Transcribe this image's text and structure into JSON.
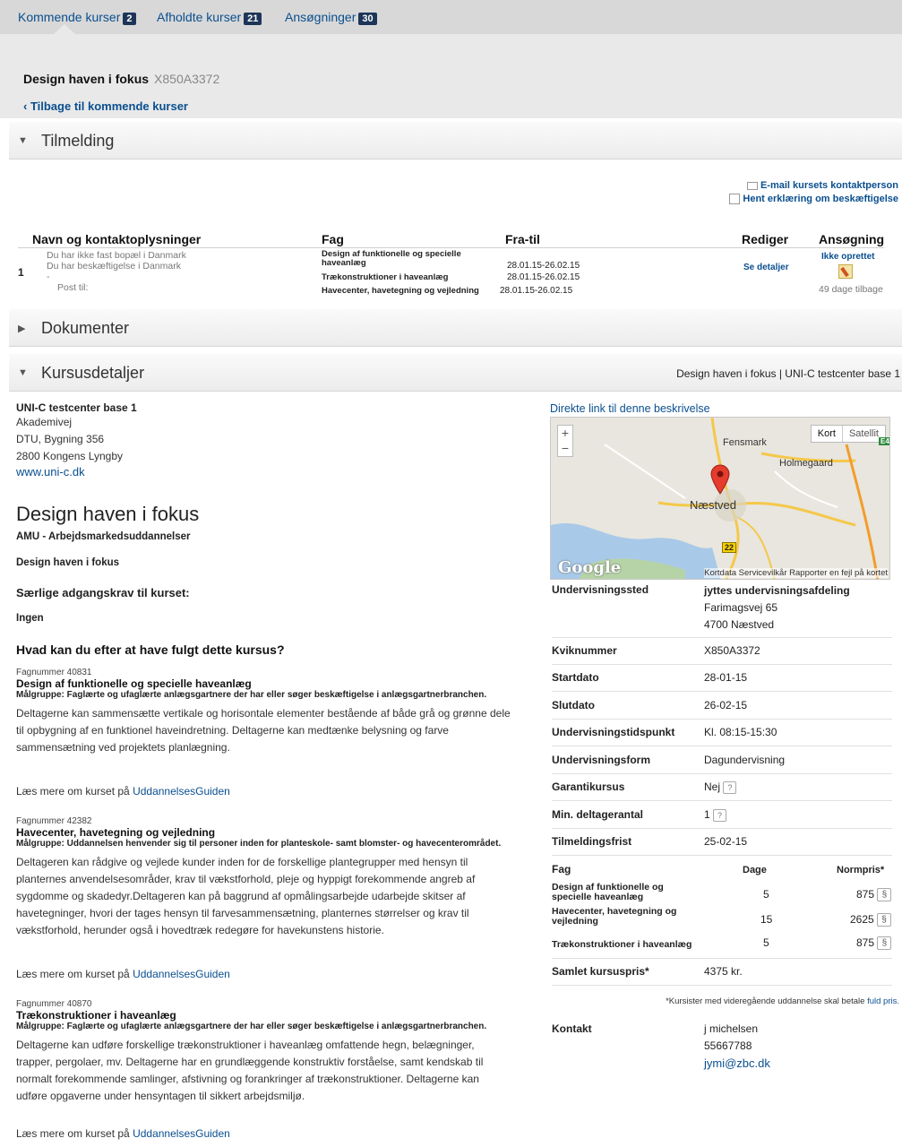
{
  "tabs": [
    {
      "label": "Kommende kurser",
      "count": "2"
    },
    {
      "label": "Afholdte kurser",
      "count": "21"
    },
    {
      "label": "Ansøgninger",
      "count": "30"
    }
  ],
  "course": {
    "title": "Design haven i fokus",
    "code": "X850A3372",
    "back": "‹ Tilbage til kommende kurser"
  },
  "sections": {
    "tilmelding": "Tilmelding",
    "dokumenter": "Dokumenter",
    "kursusdetaljer": "Kursusdetaljer"
  },
  "kursus_right_info": "Design haven i fokus | UNI-C testcenter base 1",
  "side_links": {
    "email": "E-mail kursets kontaktperson",
    "erklaering": "Hent erklæring om beskæftigelse"
  },
  "reg_table": {
    "headers": [
      "Navn og kontaktoplysninger",
      "Fag",
      "Fra-til",
      "Rediger",
      "Ansøgning"
    ],
    "row_num": "1",
    "contact": [
      "Du har ikke fast bopæl i Danmark",
      "Du har beskæftigelse i Danmark",
      "-",
      "Post til:"
    ],
    "fag": [
      {
        "name": "Design af funktionelle og specielle haveanlæg",
        "dates": "28.01.15-26.02.15"
      },
      {
        "name": "Trækonstruktioner i haveanlæg",
        "dates": "28.01.15-26.02.15"
      },
      {
        "name": "Havecenter, havetegning og vejledning",
        "dates": "28.01.15-26.02.15"
      }
    ],
    "rediger": "Se detaljer",
    "ansoegning_status": "Ikke oprettet",
    "ansoegning_days": "49 dage tilbage"
  },
  "provider": {
    "name": "UNI-C testcenter base 1",
    "addr1": "Akademivej",
    "addr2": "DTU, Bygning 356",
    "addr3": "2800 Kongens Lyngby",
    "web": "www.uni-c.dk"
  },
  "main": {
    "title": "Design haven i fokus",
    "subtitle": "AMU - Arbejdsmarkedsuddannelser",
    "name": "Design haven i fokus",
    "req_heading": "Særlige adgangskrav til kurset:",
    "req_value": "Ingen",
    "learn_heading": "Hvad kan du efter at have fulgt dette kursus?",
    "read_more_prefix": "Læs mere om kurset på ",
    "read_more_link": "UddannelsesGuiden"
  },
  "fag_details": [
    {
      "nummer": "Fagnummer 40831",
      "name": "Design af funktionelle og specielle haveanlæg",
      "maalgruppe": "Målgruppe: Faglærte og ufaglærte anlægsgartnere der har eller søger beskæftigelse i anlægsgartnerbranchen.",
      "desc": [
        "Deltagerne kan sammensætte vertikale og horisontale elementer bestående af både grå og grønne dele",
        "til opbygning af en funktionel haveindretning. Deltagerne kan medtænke belysning og farve",
        "sammensætning ved projektets planlægning."
      ]
    },
    {
      "nummer": "Fagnummer 42382",
      "name": "Havecenter, havetegning og vejledning",
      "maalgruppe": "Målgruppe: Uddannelsen henvender sig til personer inden for planteskole- samt blomster- og havecenterområdet.",
      "desc": [
        "Deltageren kan rådgive og vejlede kunder inden for de forskellige plantegrupper med hensyn til",
        "planternes anvendelsesområder, krav til vækstforhold, pleje og hyppigt forekommende angreb af",
        "sygdomme og skadedyr.Deltageren kan på baggrund af opmålingsarbejde udarbejde skitser af",
        "havetegninger, hvori der tages hensyn til farvesammensætning, planternes størrelser og krav til",
        "vækstforhold, herunder også i hovedtræk redegøre for havekunstens historie."
      ]
    },
    {
      "nummer": "Fagnummer 40870",
      "name": "Trækonstruktioner i haveanlæg",
      "maalgruppe": "Målgruppe: Faglærte og ufaglærte anlægsgartnere der har eller søger beskæftigelse i anlægsgartnerbranchen.",
      "desc": [
        "Deltagerne kan udføre forskellige trækonstruktioner i haveanlæg omfattende hegn, belægninger,",
        "trapper, pergolaer, mv. Deltagerne har en grundlæggende konstruktiv forståelse, samt kendskab til",
        "normalt forekommende samlinger, afstivning og forankringer af trækonstruktioner. Deltagerne kan",
        "udføre opgaverne under hensyntagen til sikkert arbejdsmiljø."
      ]
    }
  ],
  "map": {
    "direct_link": "Direkte link til denne beskrivelse",
    "kort": "Kort",
    "satellit": "Satellit",
    "city_main": "Næstved",
    "city_a": "Fensmark",
    "city_b": "Holmegaard",
    "road": "22",
    "road_e": "E4",
    "google": "Google",
    "footer": "Kortdata   Servicevilkår   Rapporter en fejl på kortet"
  },
  "details": {
    "sted_label": "Undervisningssted",
    "sted_name": "jyttes undervisningsafdeling",
    "sted_addr1": "Farimagsvej 65",
    "sted_addr2": "4700 Næstved",
    "kvik_label": "Kviknummer",
    "kvik": "X850A3372",
    "start_label": "Startdato",
    "start": "28-01-15",
    "slut_label": "Slutdato",
    "slut": "26-02-15",
    "tid_label": "Undervisningstidspunkt",
    "tid": "Kl. 08:15-15:30",
    "form_label": "Undervisningsform",
    "form": "Dagundervisning",
    "garanti_label": "Garantikursus",
    "garanti": "Nej",
    "min_label": "Min. deltagerantal",
    "min": "1",
    "frist_label": "Tilmeldingsfrist",
    "frist": "25-02-15",
    "qmark": "?"
  },
  "fag_table": {
    "headers": [
      "Fag",
      "Dage",
      "Normpris*"
    ],
    "rows": [
      {
        "name": "Design af funktionelle og specielle haveanlæg",
        "dage": "5",
        "pris": "875"
      },
      {
        "name": "Havecenter, havetegning og vejledning",
        "dage": "15",
        "pris": "2625"
      },
      {
        "name": "Trækonstruktioner i haveanlæg",
        "dage": "5",
        "pris": "875"
      }
    ],
    "paragraph_symbol": "§",
    "total_label": "Samlet kursuspris*",
    "total": "4375 kr.",
    "footnote": "*Kursister med videregående uddannelse skal betale ",
    "footnote_link": "fuld pris."
  },
  "contact": {
    "label": "Kontakt",
    "name": "j michelsen",
    "phone": "55667788",
    "email": "jymi@zbc.dk"
  }
}
